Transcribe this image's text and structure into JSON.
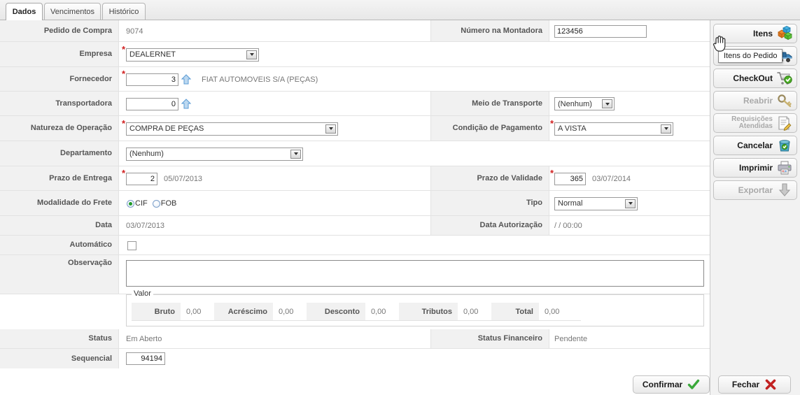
{
  "tabs": [
    {
      "label": "Dados",
      "active": true
    },
    {
      "label": "Vencimentos",
      "active": false
    },
    {
      "label": "Histórico",
      "active": false
    }
  ],
  "form": {
    "pedido_de_compra": {
      "label": "Pedido de Compra",
      "value": "9074"
    },
    "numero_na_montadora": {
      "label": "Número na Montadora",
      "value": "123456"
    },
    "empresa": {
      "label": "Empresa",
      "value": "DEALERNET",
      "required": true
    },
    "fornecedor": {
      "label": "Fornecedor",
      "code": "3",
      "description": "FIAT AUTOMOVEIS S/A (PEÇAS)",
      "required": true
    },
    "transportadora": {
      "label": "Transportadora",
      "code": "0",
      "description": ""
    },
    "meio_de_transporte": {
      "label": "Meio de Transporte",
      "value": "(Nenhum)"
    },
    "natureza_de_operacao": {
      "label": "Natureza de Operação",
      "value": "COMPRA DE PEÇAS",
      "required": true
    },
    "condicao_de_pagamento": {
      "label": "Condição de Pagamento",
      "value": "A VISTA",
      "required": true
    },
    "departamento": {
      "label": "Departamento",
      "value": "(Nenhum)"
    },
    "prazo_de_entrega": {
      "label": "Prazo de Entrega",
      "days": "2",
      "date": "05/07/2013",
      "required": true
    },
    "prazo_de_validade": {
      "label": "Prazo de Validade",
      "days": "365",
      "date": "03/07/2014",
      "required": true
    },
    "modalidade_do_frete": {
      "label": "Modalidade do Frete",
      "options": [
        {
          "label": "CIF",
          "selected": true
        },
        {
          "label": "FOB",
          "selected": false
        }
      ]
    },
    "tipo": {
      "label": "Tipo",
      "value": "Normal"
    },
    "data": {
      "label": "Data",
      "value": "03/07/2013"
    },
    "data_autorizacao": {
      "label": "Data Autorização",
      "value": "/ / 00:00"
    },
    "automatico": {
      "label": "Automático",
      "checked": false
    },
    "observacao": {
      "label": "Observação",
      "value": "",
      "placeholder": ""
    },
    "status": {
      "label": "Status",
      "value": "Em Aberto"
    },
    "status_financeiro": {
      "label": "Status Financeiro",
      "value": "Pendente"
    },
    "sequencial": {
      "label": "Sequencial",
      "value": "94194"
    }
  },
  "valor": {
    "legend": "Valor",
    "items": [
      {
        "label": "Bruto",
        "value": "0,00"
      },
      {
        "label": "Acréscimo",
        "value": "0,00"
      },
      {
        "label": "Desconto",
        "value": "0,00"
      },
      {
        "label": "Tributos",
        "value": "0,00"
      },
      {
        "label": "Total",
        "value": "0,00"
      }
    ]
  },
  "toolbar": {
    "buttons": [
      {
        "label": "Itens",
        "icon": "cubes-icon",
        "disabled": false
      },
      {
        "label": "",
        "icon": "truck-icon",
        "disabled": false
      },
      {
        "label": "CheckOut",
        "icon": "cart-check-icon",
        "disabled": false
      },
      {
        "label": "Reabrir",
        "icon": "key-icon",
        "disabled": true
      },
      {
        "label": "Requisições\nAtendidas",
        "icon": "document-edit-icon",
        "disabled": true
      },
      {
        "label": "Cancelar",
        "icon": "trash-icon",
        "disabled": false
      },
      {
        "label": "Imprimir",
        "icon": "printer-icon",
        "disabled": false
      },
      {
        "label": "Exportar",
        "icon": "download-arrow-icon",
        "disabled": true
      }
    ]
  },
  "tooltip": {
    "text": "Itens do Pedido"
  },
  "footer": {
    "confirm": {
      "label": "Confirmar",
      "icon": "green-check-icon"
    },
    "close": {
      "label": "Fechar",
      "icon": "red-x-icon"
    }
  },
  "colors": {
    "required_asterisk": "#d01f1f",
    "label_bg": "#f1f1f1",
    "confirm_check": "#3aa83a",
    "close_x": "#c22222",
    "disabled_text": "#a9a9a9"
  }
}
